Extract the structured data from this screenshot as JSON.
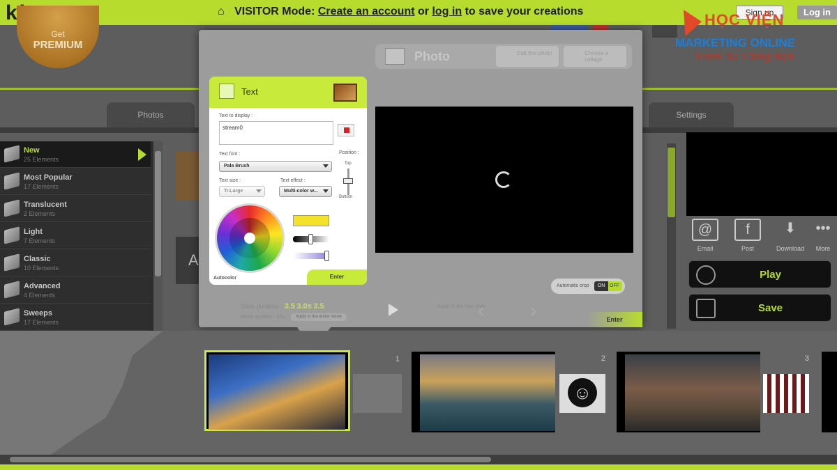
{
  "app": {
    "logo": "kizoa",
    "premium_get": "Get",
    "premium_label": "PREMIUM"
  },
  "topbar": {
    "mode": "VISITOR Mode:",
    "create_account": "Create an account",
    "or": "or",
    "log_in_link": "log in",
    "save_text": "to save your creations",
    "sign_up": "Sign up",
    "log_in": "Log in"
  },
  "watermark": {
    "line1": "HỌC VIỆN",
    "line2": "MARKETING ONLINE",
    "line3": "Vươn Xa Cùng Bạn"
  },
  "tabs": [
    {
      "label": "Photos"
    },
    {
      "label": "Settings"
    }
  ],
  "categories": [
    {
      "name": "New",
      "count": "25 Elements",
      "active": true
    },
    {
      "name": "Most Popular",
      "count": "17 Elements"
    },
    {
      "name": "Translucent",
      "count": "2 Elements"
    },
    {
      "name": "Light",
      "count": "7 Elements"
    },
    {
      "name": "Classic",
      "count": "10 Elements"
    },
    {
      "name": "Advanced",
      "count": "4 Elements"
    },
    {
      "name": "Sweeps",
      "count": "17 Elements"
    }
  ],
  "photo_dialog": {
    "title": "Photo",
    "edit_button": "Edit this photo",
    "choose_collage": "Choose a collage",
    "auto_crop": "Automatic crop",
    "auto_crop_on": "ON",
    "auto_crop_off": "OFF",
    "enter": "Enter",
    "slide_duration_label": "Slide duration :",
    "slide_duration_values": [
      "3.5",
      "3.0s",
      "3.5"
    ],
    "movie_duration": "Movie duration : 37s",
    "apply_all": "Apply to the entire movie",
    "transition_label": "Apply to the next slide"
  },
  "text_panel": {
    "title": "Text",
    "text_to_display_label": "Text to display :",
    "text_value": "stream0",
    "text_font_label": "Text font :",
    "text_font_value": "Pala Brush",
    "position_label": "Position :",
    "position_top": "Top",
    "position_bottom": "Bottom",
    "text_size_label": "Text size :",
    "text_size_value": "Tr.Large",
    "text_effect_label": "Text effect :",
    "text_effect_value": "Multi-color w...",
    "autocolor": "Autocolor",
    "enter": "Enter",
    "selected_color": "#f3e12a"
  },
  "right_panel": {
    "share": [
      {
        "label": "Email",
        "icon": "email-icon"
      },
      {
        "label": "Post",
        "icon": "facebook-icon"
      },
      {
        "label": "Download",
        "icon": "download-icon"
      },
      {
        "label": "More",
        "icon": "more-icon"
      }
    ],
    "play": "Play",
    "save": "Save"
  },
  "timeline": {
    "slides": [
      {
        "number": "1",
        "selected": true
      },
      {
        "number": "2"
      },
      {
        "number": "3"
      }
    ]
  },
  "colors": {
    "accent": "#b6dc2d",
    "panel": "#2e2e2e"
  }
}
